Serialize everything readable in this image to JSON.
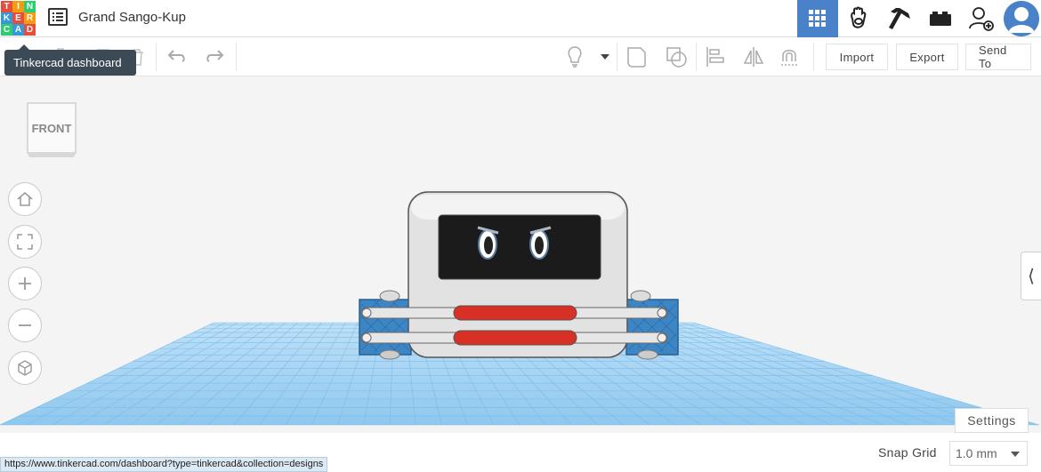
{
  "app": {
    "logo_letters": [
      "T",
      "I",
      "N",
      "K",
      "E",
      "R",
      "C",
      "A",
      "D"
    ],
    "logo_colors": [
      "#e74c3c",
      "#f39c12",
      "#2ecc71",
      "#3498db",
      "#e74c3c",
      "#f39c12",
      "#2ecc71",
      "#3498db",
      "#e74c3c"
    ],
    "design_title": "Grand Sango-Kup"
  },
  "header": {
    "icons": [
      "3d-design-grid-icon",
      "circuits-hand-icon",
      "minecraft-pickaxe-icon",
      "lego-brick-icon",
      "invite-user-icon",
      "user-avatar"
    ],
    "active_color": "#4a82c9"
  },
  "toolbar": {
    "import_label": "Import",
    "export_label": "Export",
    "send_to_label": "Send To"
  },
  "tooltip": {
    "text": "Tinkercad dashboard"
  },
  "viewcube": {
    "face_label": "FRONT"
  },
  "workplane": {
    "label": "Workplane",
    "grid_color": "#6fb6e8"
  },
  "settings": {
    "label": "Settings"
  },
  "snap_grid": {
    "label": "Snap Grid",
    "value": "1.0 mm"
  },
  "status": {
    "url": "https://www.tinkercad.com/dashboard?type=tinkercad&collection=designs"
  }
}
